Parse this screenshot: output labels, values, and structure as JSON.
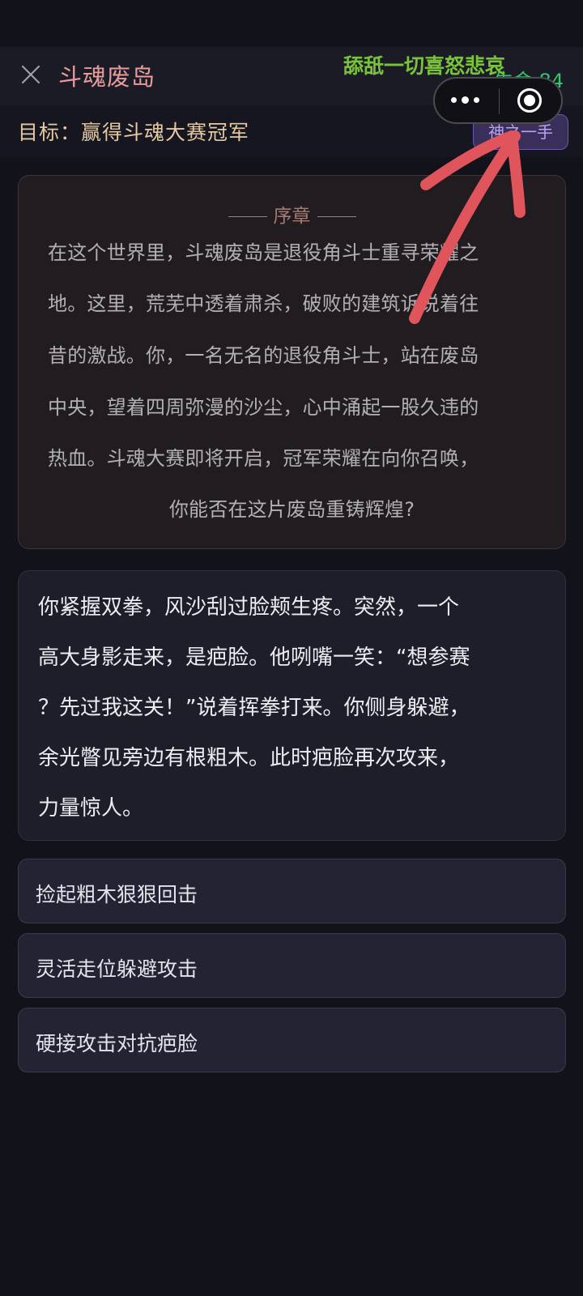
{
  "header": {
    "title": "斗魂废岛",
    "life": "生命 84",
    "watermark": "舔舐一切喜怒悲哀"
  },
  "goal": "目标：赢得斗魂大赛冠军",
  "hint_button": "神之一手",
  "prologue": {
    "heading": "序章",
    "lines": [
      "在这个世界里，斗魂废岛是退役角斗士重寻荣耀之",
      "地。这里，荒芜中透着肃杀，破败的建筑诉说着往",
      "昔的激战。你，一名无名的退役角斗士，站在废岛",
      "中央，望着四周弥漫的沙尘，心中涌起一股久违的",
      "热血。斗魂大赛即将开启，冠军荣耀在向你召唤，",
      "你能否在这片废岛重铸辉煌?"
    ]
  },
  "story": {
    "lines": [
      "你紧握双拳，风沙刮过脸颊生疼。突然，一个",
      "高大身影走来，是疤脸。他咧嘴一笑：“想参赛",
      "？先过我这关！”说着挥拳打来。你侧身躲避，",
      "余光瞥见旁边有根粗木。此时疤脸再次攻来，",
      "力量惊人。"
    ]
  },
  "choices": [
    "捡起粗木狠狠回击",
    "灵活走位躲避攻击",
    "硬接攻击对抗疤脸"
  ],
  "colors": {
    "background": "#12121a",
    "title": "#e89c9c",
    "life": "#39c16d",
    "goal": "#e4c9a2",
    "hint": "#b8a4ef",
    "annotation_arrow": "#e0545c"
  },
  "icons": {
    "close": "close-icon",
    "more": "more-dots-icon",
    "target": "target-icon"
  }
}
